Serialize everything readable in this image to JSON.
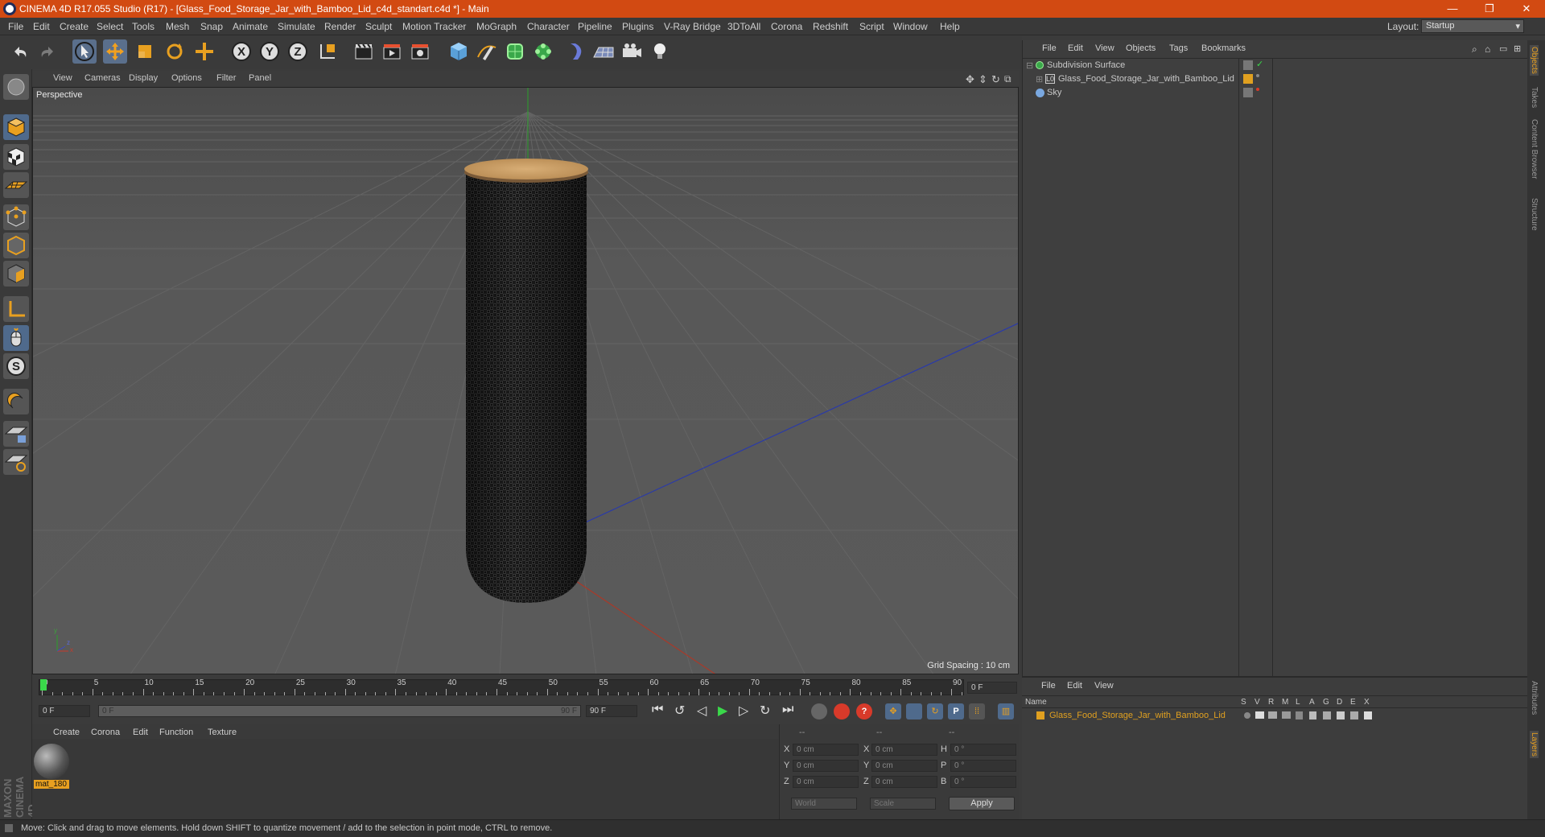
{
  "app_title": "CINEMA 4D R17.055 Studio (R17) - [Glass_Food_Storage_Jar_with_Bamboo_Lid_c4d_standart.c4d *] - Main",
  "window_controls": {
    "minimize": "—",
    "restore": "❐",
    "close": "✕"
  },
  "menu": [
    "File",
    "Edit",
    "Create",
    "Select",
    "Tools",
    "Mesh",
    "Snap",
    "Animate",
    "Simulate",
    "Render",
    "Sculpt",
    "Motion Tracker",
    "MoGraph",
    "Character",
    "Pipeline",
    "Plugins",
    "V-Ray Bridge",
    "3DToAll",
    "Corona",
    "Redshift",
    "Script",
    "Window",
    "Help"
  ],
  "layout": {
    "label": "Layout:",
    "value": "Startup"
  },
  "viewport": {
    "menu": [
      "View",
      "Cameras",
      "Display",
      "Options",
      "Filter",
      "Panel"
    ],
    "camera_label": "Perspective",
    "grid_spacing": "Grid Spacing : 10 cm"
  },
  "timeline": {
    "ticks": [
      "0",
      "5",
      "10",
      "15",
      "20",
      "25",
      "30",
      "35",
      "40",
      "45",
      "50",
      "55",
      "60",
      "65",
      "70",
      "75",
      "80",
      "85",
      "90"
    ],
    "current_frame": "0 F",
    "start_field": "0 F",
    "range_start": "0 F",
    "range_end": "90 F",
    "end_field": "90 F"
  },
  "material_panel": {
    "menu": [
      "Create",
      "Corona",
      "Edit",
      "Function",
      "Texture"
    ],
    "materials": [
      {
        "name": "mat_180"
      }
    ]
  },
  "coordinates": {
    "headers": [
      "--",
      "--",
      "--"
    ],
    "rows": [
      {
        "a": "X",
        "av": "0 cm",
        "b": "X",
        "bv": "0 cm",
        "c": "H",
        "cv": "0 °"
      },
      {
        "a": "Y",
        "av": "0 cm",
        "b": "Y",
        "bv": "0 cm",
        "c": "P",
        "cv": "0 °"
      },
      {
        "a": "Z",
        "av": "0 cm",
        "b": "Z",
        "bv": "0 cm",
        "c": "B",
        "cv": "0 °"
      }
    ],
    "space": "World",
    "mode": "Scale",
    "apply": "Apply"
  },
  "object_manager": {
    "menu": [
      "File",
      "Edit",
      "View",
      "Objects",
      "Tags",
      "Bookmarks"
    ],
    "objects": [
      {
        "name": "Subdivision Surface",
        "indent": 0
      },
      {
        "name": "Glass_Food_Storage_Jar_with_Bamboo_Lid",
        "indent": 1
      },
      {
        "name": "Sky",
        "indent": 0
      }
    ]
  },
  "layer_manager": {
    "menu": [
      "File",
      "Edit",
      "View"
    ],
    "columns": [
      "Name",
      "S",
      "V",
      "R",
      "M",
      "L",
      "A",
      "G",
      "D",
      "E",
      "X"
    ],
    "layers": [
      {
        "name": "Glass_Food_Storage_Jar_with_Bamboo_Lid",
        "color": "#e0a020"
      }
    ]
  },
  "side_tabs": [
    "Objects",
    "Takes",
    "Content Browser",
    "Structure"
  ],
  "side_tabs_bottom": [
    "Attributes",
    "Layers"
  ],
  "status": "Move: Click and drag to move elements. Hold down SHIFT to quantize movement / add to the selection in point mode, CTRL to remove.",
  "brand": "MAXON CINEMA 4D",
  "colors": {
    "accent": "#d24a12",
    "selection": "#5a6f8c",
    "layer": "#e0a020"
  }
}
